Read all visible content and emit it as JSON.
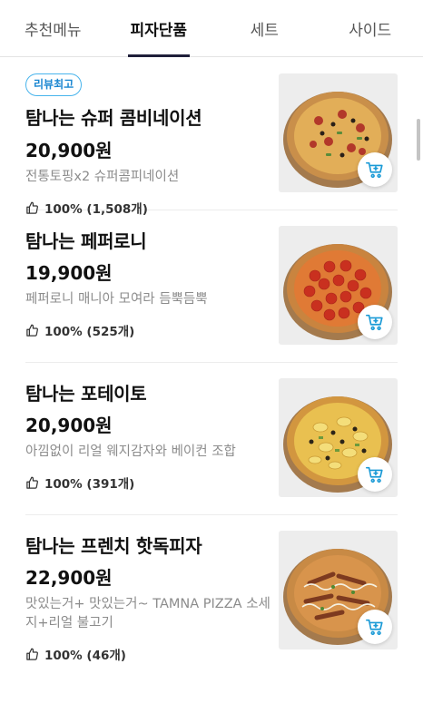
{
  "tabs": [
    {
      "label": "추천메뉴",
      "active": false
    },
    {
      "label": "피자단품",
      "active": true
    },
    {
      "label": "세트",
      "active": false
    },
    {
      "label": "사이드",
      "active": false
    }
  ],
  "colors": {
    "accent": "#1f1f3a",
    "badge": "#1a86d1",
    "cart_icon": "#1a9ad6"
  },
  "items": [
    {
      "badge": "리뷰최고",
      "name": "탐나는 슈퍼 콤비네이션",
      "price": "20,900원",
      "desc": "전통토핑x2 슈퍼콤피네이션",
      "likes": "100% (1,508개)",
      "topping": "combination"
    },
    {
      "name": "탐나는 페퍼로니",
      "price": "19,900원",
      "desc": "페퍼로니 매니아 모여라 듬뿍듬뿍",
      "likes": "100% (525개)",
      "topping": "pepperoni"
    },
    {
      "name": "탐나는 포테이토",
      "price": "20,900원",
      "desc": "아낌없이 리얼 웨지감자와 베이컨 조합",
      "likes": "100% (391개)",
      "topping": "potato"
    },
    {
      "name": "탐나는 프렌치 핫독피자",
      "price": "22,900원",
      "desc": "맛있는거+ 맛있는거~ TAMNA PIZZA 소세지+리얼 불고기",
      "likes": "100% (46개)",
      "topping": "hotdog"
    }
  ]
}
